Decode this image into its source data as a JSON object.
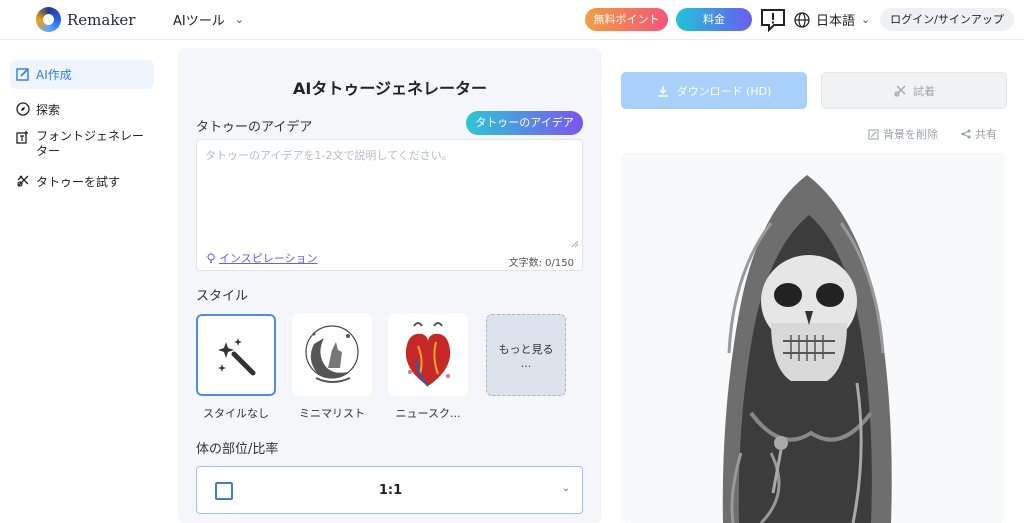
{
  "header": {
    "logo_text": "Remaker",
    "ai_tools_label": "AIツール",
    "free_points_label": "無料ポイント",
    "pricing_label": "料金",
    "language_label": "日本語",
    "login_label": "ログイン/サインアップ"
  },
  "sidebar": {
    "items": [
      {
        "label": "AI作成",
        "icon": "edit-icon"
      },
      {
        "label": "探索",
        "icon": "compass-icon"
      },
      {
        "label": "フォントジェネレーター",
        "icon": "font-icon"
      },
      {
        "label": "タトゥーを試す",
        "icon": "tattoo-icon"
      }
    ]
  },
  "form": {
    "title": "AIタトゥージェネレーター",
    "idea_label": "タトゥーのアイデア",
    "idea_button": "タトゥーのアイデア",
    "idea_placeholder": "タトゥーのアイデアを1-2文で説明してください。",
    "inspiration_link": "インスピレーション",
    "char_count": "文字数: 0/150",
    "style_label": "スタイル",
    "styles": [
      {
        "name": "スタイルなし"
      },
      {
        "name": "ミニマリスト"
      },
      {
        "name": "ニュースク..."
      }
    ],
    "more_label": "もっと見る",
    "more_dots": "...",
    "body_ratio_label": "体の部位/比率",
    "ratio_value": "1:1"
  },
  "actions": {
    "download_label": "ダウンロード (HD)",
    "tryon_label": "試着",
    "remove_bg_label": "背景を削除",
    "share_label": "共有"
  },
  "colors": {
    "accent": "#2b7de9",
    "free_gradient": [
      "#f59e42",
      "#f2557a"
    ],
    "pricing_gradient": [
      "#22c3d6",
      "#6b5cf0"
    ]
  }
}
